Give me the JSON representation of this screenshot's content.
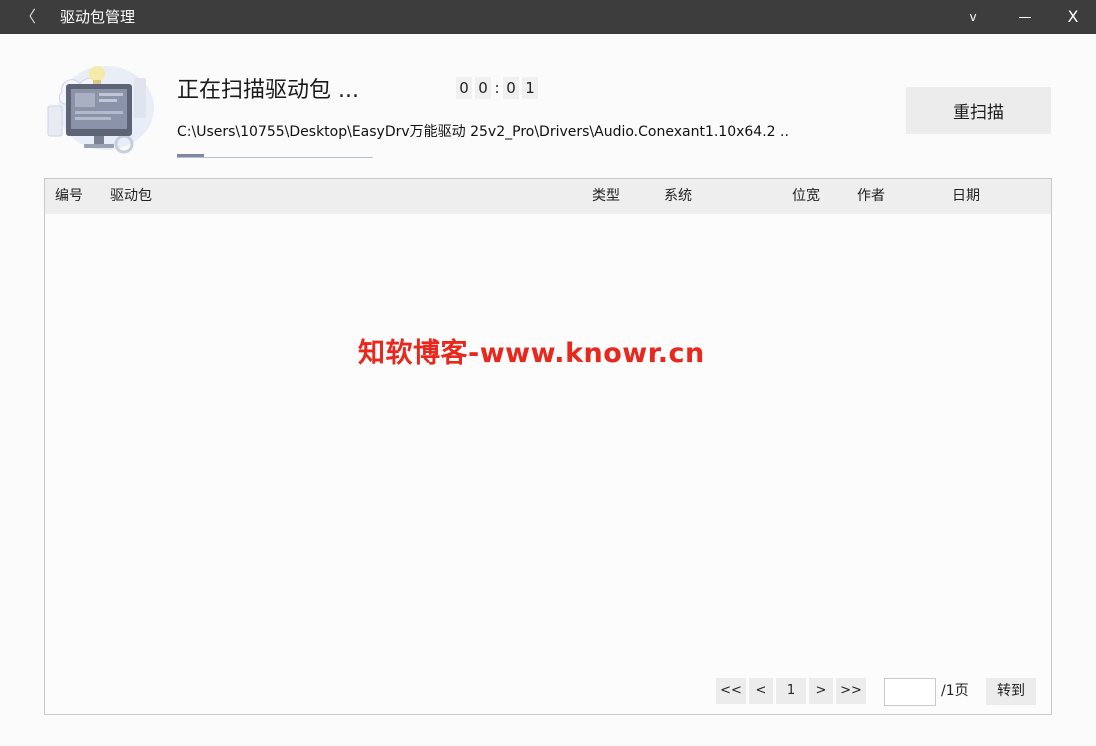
{
  "window": {
    "back_glyph": "〈",
    "title": "驱动包管理",
    "dropdown_glyph": "v",
    "close_glyph": "X"
  },
  "scan": {
    "title": "正在扫描驱动包 ...",
    "timer_digits": [
      "0",
      "0",
      "0",
      "1"
    ],
    "timer_colon": ":",
    "path": "C:\\Users\\10755\\Desktop\\EasyDrv万能驱动 25v2_Pro\\Drivers\\Audio.Conexant1.10x64.2 ..",
    "progress_fraction": 0.14
  },
  "rescan_button": "重扫描",
  "table": {
    "columns": [
      "编号",
      "驱动包",
      "类型",
      "系统",
      "位宽",
      "作者",
      "日期"
    ],
    "rows": []
  },
  "watermark": "知软博客-www.knowr.cn",
  "pagination": {
    "first": "<<",
    "prev": "<",
    "current": "1",
    "next": ">",
    "last": ">>",
    "page_input": "",
    "total": "/1页",
    "goto": "转到"
  }
}
